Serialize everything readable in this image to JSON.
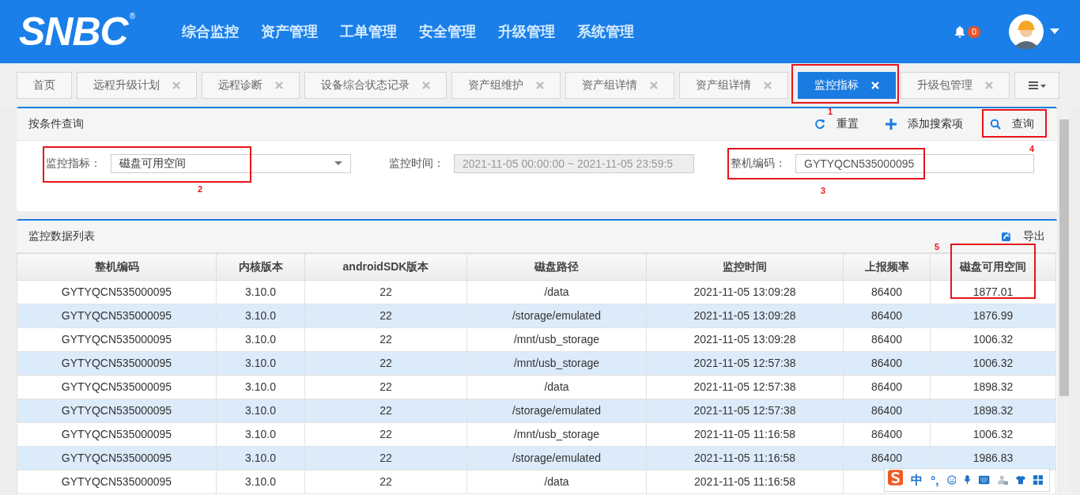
{
  "header": {
    "logo": "SNBC",
    "logo_mark": "®",
    "nav": [
      "综合监控",
      "资产管理",
      "工单管理",
      "安全管理",
      "升级管理",
      "系统管理"
    ],
    "notification_count": "0"
  },
  "tabs": [
    {
      "label": "首页",
      "closable": false,
      "selected": false
    },
    {
      "label": "远程升级计划",
      "closable": true,
      "selected": false
    },
    {
      "label": "远程诊断",
      "closable": true,
      "selected": false
    },
    {
      "label": "设备综合状态记录",
      "closable": true,
      "selected": false
    },
    {
      "label": "资产组维护",
      "closable": true,
      "selected": false
    },
    {
      "label": "资产组详情",
      "closable": true,
      "selected": false
    },
    {
      "label": "资产组详情",
      "closable": true,
      "selected": false
    },
    {
      "label": "监控指标",
      "closable": true,
      "selected": true,
      "annotation": "1"
    },
    {
      "label": "升级包管理",
      "closable": true,
      "selected": false
    }
  ],
  "query_panel": {
    "title": "按条件查询",
    "actions": [
      {
        "kind": "reset",
        "label": "重置"
      },
      {
        "kind": "add",
        "label": "添加搜索项"
      },
      {
        "kind": "search",
        "label": "查询",
        "annotation": "4"
      }
    ],
    "fields": [
      {
        "kind": "select",
        "label": "监控指标：",
        "value": "磁盘可用空间",
        "disabled": false,
        "annotation": "2"
      },
      {
        "kind": "text",
        "label": "监控时间：",
        "value": "2021-11-05 00:00:00 ~ 2021-11-05 23:59:5",
        "disabled": true
      },
      {
        "kind": "text",
        "label": "整机编码：",
        "value": "GYTYQCN535000095",
        "disabled": false,
        "annotation": "3"
      }
    ]
  },
  "table": {
    "title": "监控数据列表",
    "export_label": "导出",
    "columns": [
      {
        "label": "整机编码"
      },
      {
        "label": "内核版本"
      },
      {
        "label": "androidSDK版本"
      },
      {
        "label": "磁盘路径"
      },
      {
        "label": "监控时间"
      },
      {
        "label": "上报频率"
      },
      {
        "label": "磁盘可用空间",
        "annotation": "5"
      }
    ],
    "rows": [
      [
        "GYTYQCN535000095",
        "3.10.0",
        "22",
        "/data",
        "2021-11-05 13:09:28",
        "86400",
        "1877.01"
      ],
      [
        "GYTYQCN535000095",
        "3.10.0",
        "22",
        "/storage/emulated",
        "2021-11-05 13:09:28",
        "86400",
        "1876.99"
      ],
      [
        "GYTYQCN535000095",
        "3.10.0",
        "22",
        "/mnt/usb_storage",
        "2021-11-05 13:09:28",
        "86400",
        "1006.32"
      ],
      [
        "GYTYQCN535000095",
        "3.10.0",
        "22",
        "/mnt/usb_storage",
        "2021-11-05 12:57:38",
        "86400",
        "1006.32"
      ],
      [
        "GYTYQCN535000095",
        "3.10.0",
        "22",
        "/data",
        "2021-11-05 12:57:38",
        "86400",
        "1898.32"
      ],
      [
        "GYTYQCN535000095",
        "3.10.0",
        "22",
        "/storage/emulated",
        "2021-11-05 12:57:38",
        "86400",
        "1898.32"
      ],
      [
        "GYTYQCN535000095",
        "3.10.0",
        "22",
        "/mnt/usb_storage",
        "2021-11-05 11:16:58",
        "86400",
        "1006.32"
      ],
      [
        "GYTYQCN535000095",
        "3.10.0",
        "22",
        "/storage/emulated",
        "2021-11-05 11:16:58",
        "86400",
        "1986.83"
      ],
      [
        "GYTYQCN535000095",
        "3.10.0",
        "22",
        "/data",
        "2021-11-05 11:16:58"
      ]
    ]
  },
  "ime_toolbar": {
    "mode": "中",
    "punctuation": "°,"
  }
}
